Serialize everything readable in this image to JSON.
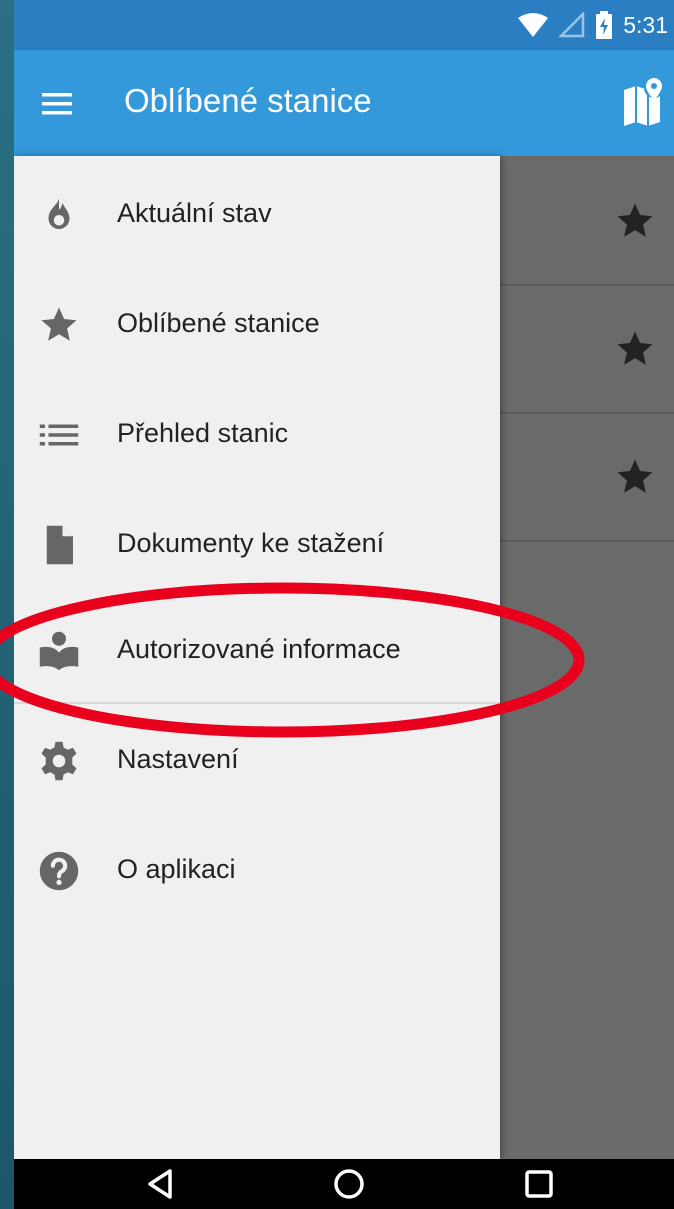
{
  "status_bar": {
    "time": "5:31",
    "icons": [
      "wifi-icon",
      "signal-icon",
      "battery-charging-icon"
    ]
  },
  "app_bar": {
    "title": "Oblíbené stanice",
    "menu_icon": "hamburger-menu-icon",
    "action_icon": "map-icon"
  },
  "drawer": {
    "items": [
      {
        "label": "Aktuální stav",
        "icon": "flame-icon"
      },
      {
        "label": "Oblíbené stanice",
        "icon": "star-icon"
      },
      {
        "label": "Přehled stanic",
        "icon": "list-icon"
      },
      {
        "label": "Dokumenty ke stažení",
        "icon": "document-icon"
      },
      {
        "label": "Autorizované informace",
        "icon": "reader-icon"
      },
      {
        "label": "Nastavení",
        "icon": "gear-icon"
      },
      {
        "label": "O aplikaci",
        "icon": "help-icon"
      }
    ]
  },
  "favorites": {
    "rows": [
      {
        "icon": "star-icon"
      },
      {
        "icon": "star-icon"
      },
      {
        "icon": "star-icon"
      }
    ]
  },
  "nav_bar": {
    "buttons": [
      "back-icon",
      "home-icon",
      "recents-icon"
    ]
  },
  "colors": {
    "app_bar": "#3399db",
    "status_bar": "#2b7ec2",
    "drawer_bg": "#f0f0f0",
    "scrim": "#6a6a6a",
    "highlight": "#e8001c"
  }
}
